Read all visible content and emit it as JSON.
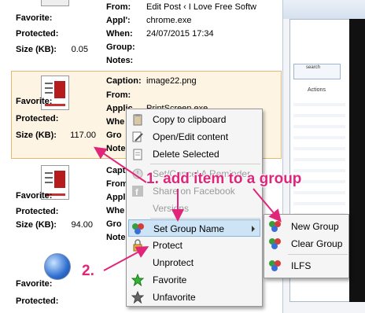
{
  "items": [
    {
      "rows": [
        {
          "label": "Favorite:",
          "value": ""
        },
        {
          "label": "Protected:",
          "value": ""
        },
        {
          "label": "Size (KB):",
          "value": "0.05"
        }
      ],
      "meta": [
        {
          "label": "From:",
          "value": "Edit Post ‹ I Love Free Softw"
        },
        {
          "label": "Appl':",
          "value": "chrome.exe"
        },
        {
          "label": "When:",
          "value": "24/07/2015 17:34"
        },
        {
          "label": "Group:",
          "value": ""
        },
        {
          "label": "Notes:",
          "value": ""
        }
      ]
    },
    {
      "rows": [
        {
          "label": "Favorite:",
          "value": ""
        },
        {
          "label": "Protected:",
          "value": ""
        },
        {
          "label": "Size (KB):",
          "value": "117.00"
        }
      ],
      "meta": [
        {
          "label": "Caption:",
          "value": "image22.png"
        },
        {
          "label": "From:",
          "value": ""
        },
        {
          "label": "Applic",
          "value": "PrintScreen.exe"
        },
        {
          "label": "Whe",
          "value": ""
        },
        {
          "label": "Gro",
          "value": ""
        },
        {
          "label": "Note",
          "value": ""
        }
      ]
    },
    {
      "rows": [
        {
          "label": "Favorite:",
          "value": ""
        },
        {
          "label": "Protected:",
          "value": ""
        },
        {
          "label": "Size (KB):",
          "value": "94.00"
        }
      ],
      "meta": [
        {
          "label": "Captio",
          "value": ""
        },
        {
          "label": "From",
          "value": ""
        },
        {
          "label": "Appli",
          "value": ""
        },
        {
          "label": "Whe",
          "value": ""
        },
        {
          "label": "Gro",
          "value": ""
        },
        {
          "label": "Note",
          "value": ""
        }
      ]
    },
    {
      "rows": [
        {
          "label": "Favorite:",
          "value": ""
        },
        {
          "label": "Protected:",
          "value": ""
        }
      ],
      "meta": []
    }
  ],
  "context_menu": {
    "items": [
      {
        "label": "Copy to clipboard",
        "icon": "clipboard-icon",
        "disabled": false
      },
      {
        "label": "Open/Edit content",
        "icon": "edit-icon",
        "disabled": false
      },
      {
        "label": "Delete Selected",
        "icon": "delete-icon",
        "disabled": false
      },
      {
        "label": "Set/Cancel A Reminder",
        "icon": "clock-icon",
        "disabled": true
      },
      {
        "label": "Share on Facebook",
        "icon": "facebook-icon",
        "disabled": true
      },
      {
        "label": "Versions",
        "icon": "",
        "disabled": true
      },
      {
        "label": "Set Group Name",
        "icon": "group-icon",
        "disabled": false,
        "highlighted": true,
        "submenu": true
      },
      {
        "label": "Protect",
        "icon": "lock-icon",
        "disabled": false
      },
      {
        "label": "Unprotect",
        "icon": "unlock-icon",
        "disabled": false
      },
      {
        "label": "Favorite",
        "icon": "star-green-icon",
        "disabled": false
      },
      {
        "label": "Unfavorite",
        "icon": "star-gray-icon",
        "disabled": false
      }
    ]
  },
  "submenu": {
    "items": [
      {
        "label": "New Group",
        "icon": "group-add-icon"
      },
      {
        "label": "Clear Group",
        "icon": "group-clear-icon"
      },
      {
        "label": "ILFS",
        "icon": "group-icon"
      }
    ]
  },
  "annotations": {
    "step1": "1. add item to a group",
    "step2": "2."
  },
  "right_window": {
    "search_label": "search",
    "actions_label": "Actions"
  },
  "colors": {
    "annotation": "#e0257a",
    "selection_bg": "#fdf4e3",
    "menu_highlight": "#cde4f7"
  }
}
